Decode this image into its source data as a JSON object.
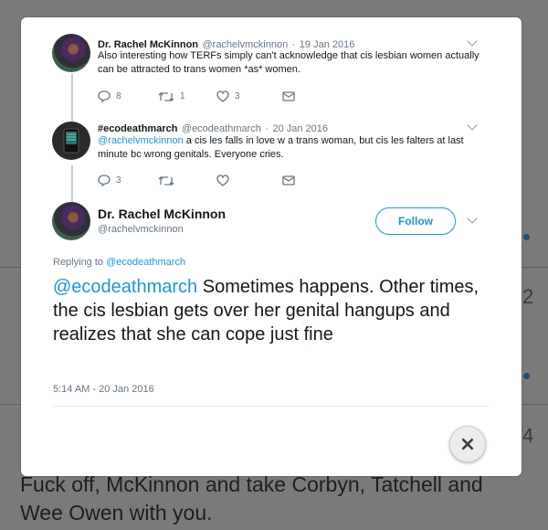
{
  "background": {
    "text_line1": "Fuck off, McKinnon and take Corbyn, Tatchell and",
    "text_line2": "Wee Owen with you.",
    "counts": [
      "2",
      "4"
    ]
  },
  "thread": [
    {
      "name": "Dr. Rachel McKinnon",
      "handle": "@rachelvmckinnon",
      "separator": "·",
      "date": "19 Jan 2016",
      "text": "Also interesting how TERFs simply can't acknowledge that cis lesbian women actually can be attracted to trans women *as* women.",
      "replies": "8",
      "retweets": "1",
      "likes": "3"
    },
    {
      "name": "#ecodeathmarch",
      "handle": "@ecodeathmarch",
      "separator": "·",
      "date": "20 Jan 2016",
      "mention": "@rachelvmckinnon",
      "text": " a cis les falls in love w a trans woman, but cis les falters at last minute bc wrong genitals. Everyone cries.",
      "replies": "3",
      "retweets": "",
      "likes": ""
    }
  ],
  "main_tweet": {
    "name": "Dr. Rachel McKinnon",
    "handle": "@rachelvmckinnon",
    "follow_label": "Follow",
    "replying_prefix": "Replying to ",
    "replying_to": "@ecodeathmarch",
    "mention": "@ecodeathmarch",
    "text": " Sometimes happens. Other times, the cis lesbian gets over her genital hangups and realizes that she can cope just fine",
    "timestamp": "5:14 AM - 20 Jan 2016"
  },
  "close_label": "×",
  "colors": {
    "accent": "#1b95e0",
    "text": "#14171a",
    "muted": "#657786"
  }
}
